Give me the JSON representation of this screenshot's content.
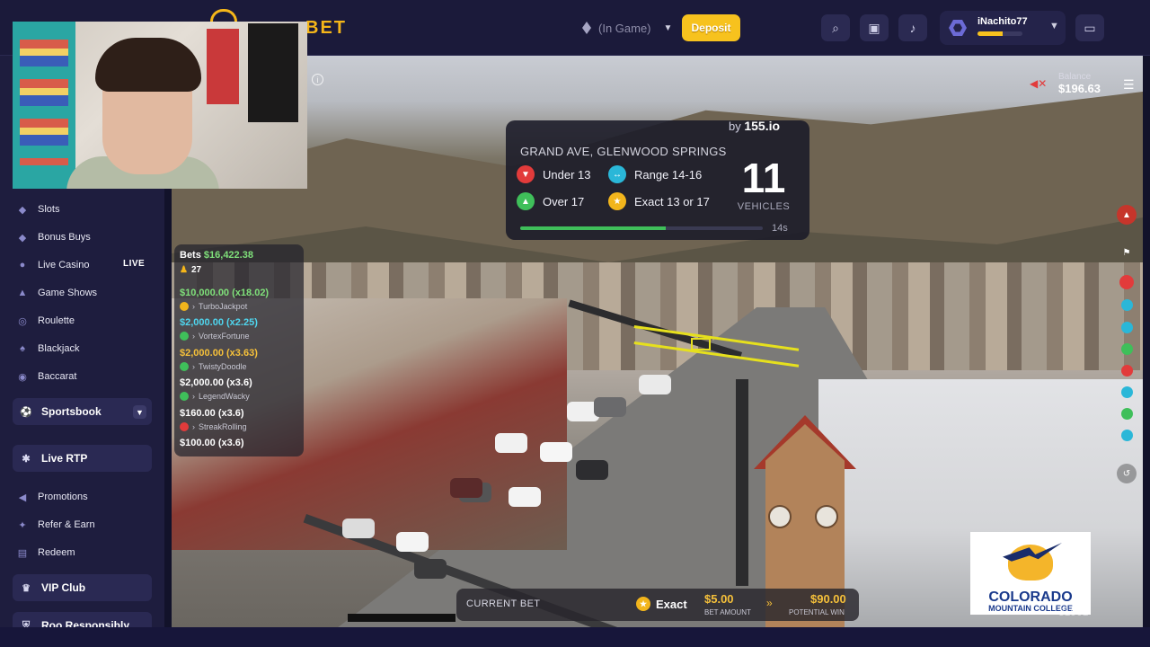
{
  "topbar": {
    "logo_text": "BET",
    "currency": "(In Game)",
    "deposit_label": "Deposit",
    "user": {
      "name": "iNachito77",
      "level_progress": 0.55
    }
  },
  "sidebar": {
    "items": [
      {
        "label": "Slots",
        "icon": "slot-icon"
      },
      {
        "label": "Bonus Buys",
        "icon": "gem-icon"
      },
      {
        "label": "Live Casino",
        "icon": "camera-icon",
        "badge": "LIVE"
      },
      {
        "label": "Game Shows",
        "icon": "trophy-icon"
      },
      {
        "label": "Roulette",
        "icon": "roulette-icon"
      },
      {
        "label": "Blackjack",
        "icon": "cards-icon"
      },
      {
        "label": "Baccarat",
        "icon": "chip-icon"
      }
    ],
    "sportsbook": "Sportsbook",
    "live_rtp": "Live RTP",
    "items2": [
      {
        "label": "Promotions",
        "icon": "megaphone-icon"
      },
      {
        "label": "Refer & Earn",
        "icon": "handshake-icon"
      },
      {
        "label": "Redeem",
        "icon": "redeem-icon"
      }
    ],
    "vip_club": "VIP Club",
    "responsibly": "Roo Responsibly"
  },
  "stream": {
    "balance_label": "Balance",
    "balance_value": "$196.63",
    "camera_id": "31901",
    "market": {
      "by_prefix": "by",
      "provider": "155.io",
      "location": "GRAND AVE, GLENWOOD SPRINGS",
      "options": [
        {
          "label": "Under 13",
          "color": "red"
        },
        {
          "label": "Range 14-16",
          "color": "cyan"
        },
        {
          "label": "Over 17",
          "color": "green"
        },
        {
          "label": "Exact 13 or 17",
          "color": "gold"
        }
      ],
      "count": "11",
      "count_label": "VEHICLES",
      "timer": "14s",
      "progress": 0.6
    },
    "bets": {
      "title": "Bets",
      "total": "$16,422.38",
      "players": "27",
      "rows": [
        {
          "amount": "$10,000.00",
          "mult": "(x18.02)",
          "color": "#7fe07a",
          "user": "TurboJackpot",
          "user_color": "#f2b51c"
        },
        {
          "amount": "$2,000.00",
          "mult": "(x2.25)",
          "color": "#4fd6ef",
          "user": "VortexFortune",
          "user_color": "#3fbf5a"
        },
        {
          "amount": "$2,000.00",
          "mult": "(x3.63)",
          "color": "#f5c03a",
          "user": "TwistyDoodle",
          "user_color": "#3fbf5a"
        },
        {
          "amount": "$2,000.00",
          "mult": "(x3.6)",
          "color": "#ffffff",
          "user": "LegendWacky",
          "user_color": "#3fbf5a"
        },
        {
          "amount": "$160.00",
          "mult": "(x3.6)",
          "color": "#ffffff",
          "user": "StreakRolling",
          "user_color": "#e23b3b"
        },
        {
          "amount": "$100.00",
          "mult": "(x3.6)",
          "color": "#ffffff",
          "user": "",
          "user_color": "#3fbf5a"
        }
      ]
    },
    "current_bet": {
      "title": "CURRENT BET",
      "choice": "Exact",
      "amount": "$5.00",
      "amount_label": "BET AMOUNT",
      "win": "$90.00",
      "win_label": "POTENTIAL WIN"
    },
    "sponsor": {
      "line1": "COLORADO",
      "line2": "MOUNTAIN COLLEGE"
    }
  },
  "colors": {
    "accent": "#f7c21e",
    "sidebar": "#1e1d3e",
    "topbar": "#1b1a3a"
  }
}
